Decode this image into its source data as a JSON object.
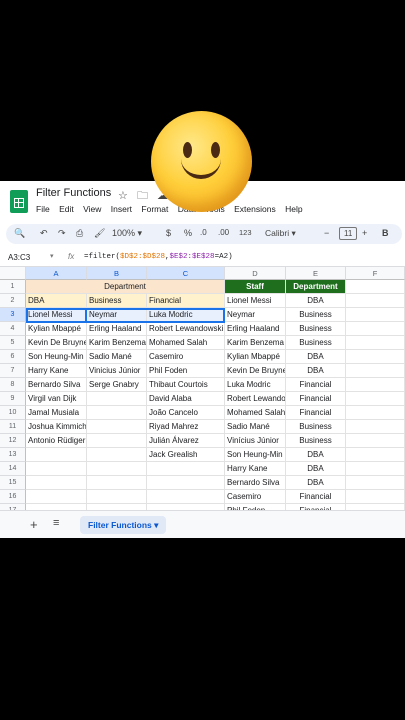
{
  "app": {
    "doc_title": "Filter Functions",
    "title_icons": [
      "star-icon",
      "folder-move-icon",
      "cloud-status-icon"
    ],
    "menus": [
      "File",
      "Edit",
      "View",
      "Insert",
      "Format",
      "Data",
      "Tools",
      "Extensions",
      "Help"
    ]
  },
  "toolbar": {
    "zoom": "100%",
    "currency": "$",
    "percent": "%",
    "dec_decrease": ".0",
    "dec_increase": ".00",
    "number_format": "123",
    "font": "Calibri",
    "font_size": "11",
    "bold": "B"
  },
  "formula_bar": {
    "name_box": "A3:C3",
    "fx": "fx",
    "formula_prefix": "=filter(",
    "range1": "$D$2:$D$28",
    "comma": ",",
    "range2": "$E$2:$E$28",
    "criteria": "=A2",
    "close": ")"
  },
  "columns": [
    "A",
    "B",
    "C",
    "D",
    "E",
    "F"
  ],
  "rows": [
    "1",
    "2",
    "3",
    "4",
    "5",
    "6",
    "7",
    "8",
    "9",
    "10",
    "11",
    "12",
    "13",
    "14",
    "15",
    "16",
    "17"
  ],
  "sheet": {
    "department_banner": "Department",
    "dept_headers": [
      "DBA",
      "Business",
      "Financial"
    ],
    "col_a": [
      "Lionel Messi",
      "Kylian Mbappé",
      "Kevin De Bruyne",
      "Son Heung-Min",
      "Harry Kane",
      "Bernardo Silva",
      "Virgil van Dijk",
      "Jamal Musiala",
      "Joshua Kimmich",
      "Antonio Rüdiger"
    ],
    "col_b": [
      "Neymar",
      "Erling Haaland",
      "Karim Benzema",
      "Sadio Mané",
      "Vinicius Júnior",
      "Serge Gnabry"
    ],
    "col_c": [
      "Luka Modric",
      "Robert Lewandowski",
      "Mohamed Salah",
      "Casemiro",
      "Phil Foden",
      "Thibaut Courtois",
      "David Alaba",
      "João Cancelo",
      "Riyad Mahrez",
      "Julián Álvarez",
      "Jack Grealish"
    ],
    "staff_header": "Staff",
    "department_header": "Department",
    "staff": [
      "Lionel Messi",
      "Neymar",
      "Erling Haaland",
      "Karim Benzema",
      "Kylian Mbappé",
      "Kevin De Bruyne",
      "Luka Modric",
      "Robert Lewando",
      "Mohamed Salah",
      "Sadio Mané",
      "Vinícius Júnior",
      "Son Heung-Min",
      "Harry Kane",
      "Bernardo Silva",
      "Casemiro",
      "Phil Foden"
    ],
    "departments": [
      "DBA",
      "Business",
      "Business",
      "Business",
      "DBA",
      "DBA",
      "Financial",
      "Financial",
      "Financial",
      "Business",
      "Business",
      "DBA",
      "DBA",
      "DBA",
      "Financial",
      "Financial"
    ]
  },
  "sheet_tabs": {
    "add": "+",
    "all_sheets": "≡",
    "active": "Filter Functions"
  },
  "overlay": {
    "emoji": "slightly-smiling-face-emoji"
  }
}
